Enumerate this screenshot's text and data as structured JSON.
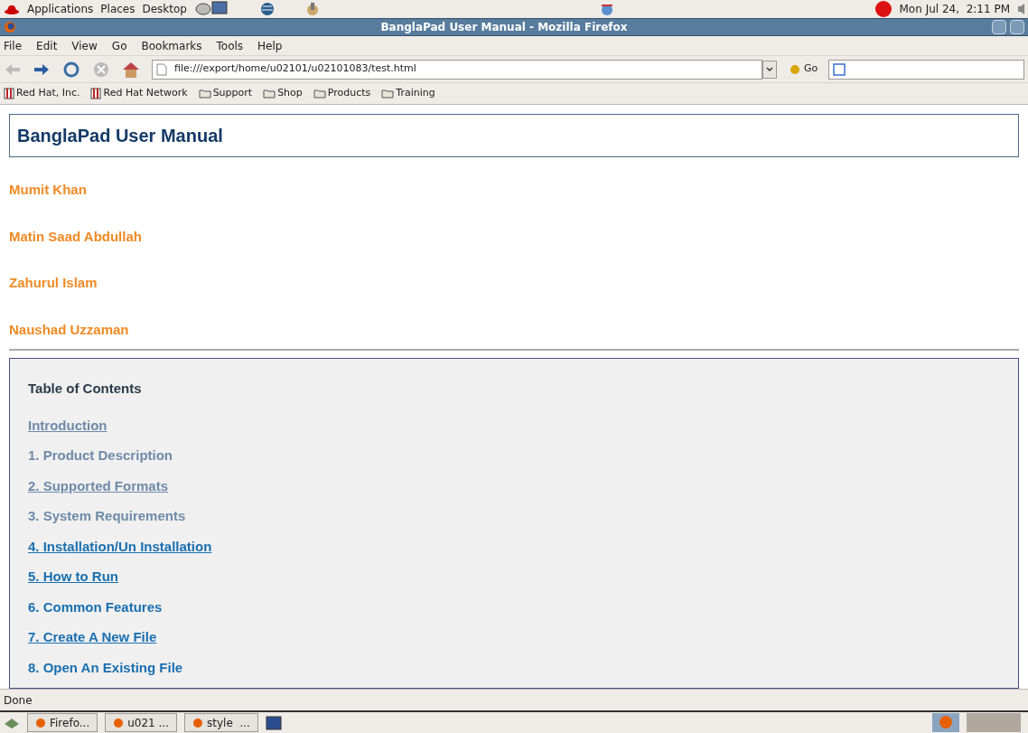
{
  "top_panel": {
    "menus": [
      "Applications",
      "Places",
      "Desktop"
    ],
    "clock": "Mon Jul 24,  2:11 PM"
  },
  "window": {
    "title": "BanglaPad User Manual - Mozilla Firefox"
  },
  "menu_bar": [
    "File",
    "Edit",
    "View",
    "Go",
    "Bookmarks",
    "Tools",
    "Help"
  ],
  "navigation": {
    "address": "file:///export/home/u02101/u02101083/test.html",
    "go_label": "Go"
  },
  "bookmarks": [
    {
      "label": "Red Hat, Inc.",
      "kind": "site"
    },
    {
      "label": "Red Hat Network",
      "kind": "site"
    },
    {
      "label": "Support",
      "kind": "folder"
    },
    {
      "label": "Shop",
      "kind": "folder"
    },
    {
      "label": "Products",
      "kind": "folder"
    },
    {
      "label": "Training",
      "kind": "folder"
    }
  ],
  "page": {
    "heading": "BanglaPad User Manual",
    "authors": [
      "Mumit Khan",
      "Matin Saad Abdullah",
      "Zahurul Islam",
      "Naushad Uzzaman"
    ],
    "toc": {
      "title": "Table of Contents",
      "items": [
        {
          "label": "Introduction",
          "visited": true,
          "underlined": true
        },
        {
          "label": "1. Product Description",
          "visited": true,
          "underlined": false
        },
        {
          "label": "2. Supported Formats",
          "visited": true,
          "underlined": true
        },
        {
          "label": "3. System Requirements",
          "visited": true,
          "underlined": false
        },
        {
          "label": "4. Installation/Un Installation",
          "visited": false,
          "underlined": true
        },
        {
          "label": "5. How to Run",
          "visited": false,
          "underlined": true
        },
        {
          "label": "6. Common Features",
          "visited": false,
          "underlined": false
        },
        {
          "label": "7. Create A New File",
          "visited": false,
          "underlined": true
        },
        {
          "label": "8. Open An Existing File",
          "visited": false,
          "underlined": false
        }
      ]
    }
  },
  "status_bar": "Done",
  "taskbar": [
    "Firefo...",
    "u021 ...",
    "style  ..."
  ]
}
